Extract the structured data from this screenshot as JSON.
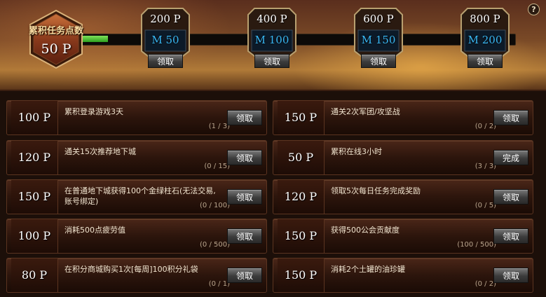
{
  "header": {
    "accumulated_label": "累积任务点数",
    "accumulated_value": "50 P",
    "progress_fraction": 0.07,
    "help_label": "?",
    "milestones": [
      {
        "points": "200 P",
        "reward": "M 50",
        "button": "领取"
      },
      {
        "points": "400 P",
        "reward": "M 100",
        "button": "领取"
      },
      {
        "points": "600 P",
        "reward": "M 150",
        "button": "领取"
      },
      {
        "points": "800 P",
        "reward": "M 200",
        "button": "领取"
      }
    ]
  },
  "tasks": {
    "left": [
      {
        "points": "100 P",
        "desc": "累积登录游戏3天",
        "progress": "(1 / 3)",
        "button": "领取"
      },
      {
        "points": "120 P",
        "desc": "通关15次推荐地下城",
        "progress": "(0 / 15)",
        "button": "领取"
      },
      {
        "points": "150 P",
        "desc": "在普通地下城获得100个金绿柱石(无法交易, 账号绑定)",
        "progress": "(0 / 100)",
        "button": "领取"
      },
      {
        "points": "100 P",
        "desc": "消耗500点疲劳值",
        "progress": "(0 / 500)",
        "button": "领取"
      },
      {
        "points": "80 P",
        "desc": "在积分商城购买1次[每周]100积分礼袋",
        "progress": "(0 / 1)",
        "button": "领取"
      }
    ],
    "right": [
      {
        "points": "150 P",
        "desc": "通关2次军团/攻坚战",
        "progress": "(0 / 2)",
        "button": "领取"
      },
      {
        "points": "50 P",
        "desc": "累积在线3小时",
        "progress": "(3 / 3)",
        "button": "完成"
      },
      {
        "points": "120 P",
        "desc": "领取5次每日任务完成奖励",
        "progress": "(0 / 5)",
        "button": "领取"
      },
      {
        "points": "150 P",
        "desc": "获得500公会贡献度",
        "progress": "(100 / 500)",
        "button": "领取"
      },
      {
        "points": "150 P",
        "desc": "消耗2个土罐的油珍罐",
        "progress": "(0 / 2)",
        "button": "领取"
      }
    ]
  }
}
